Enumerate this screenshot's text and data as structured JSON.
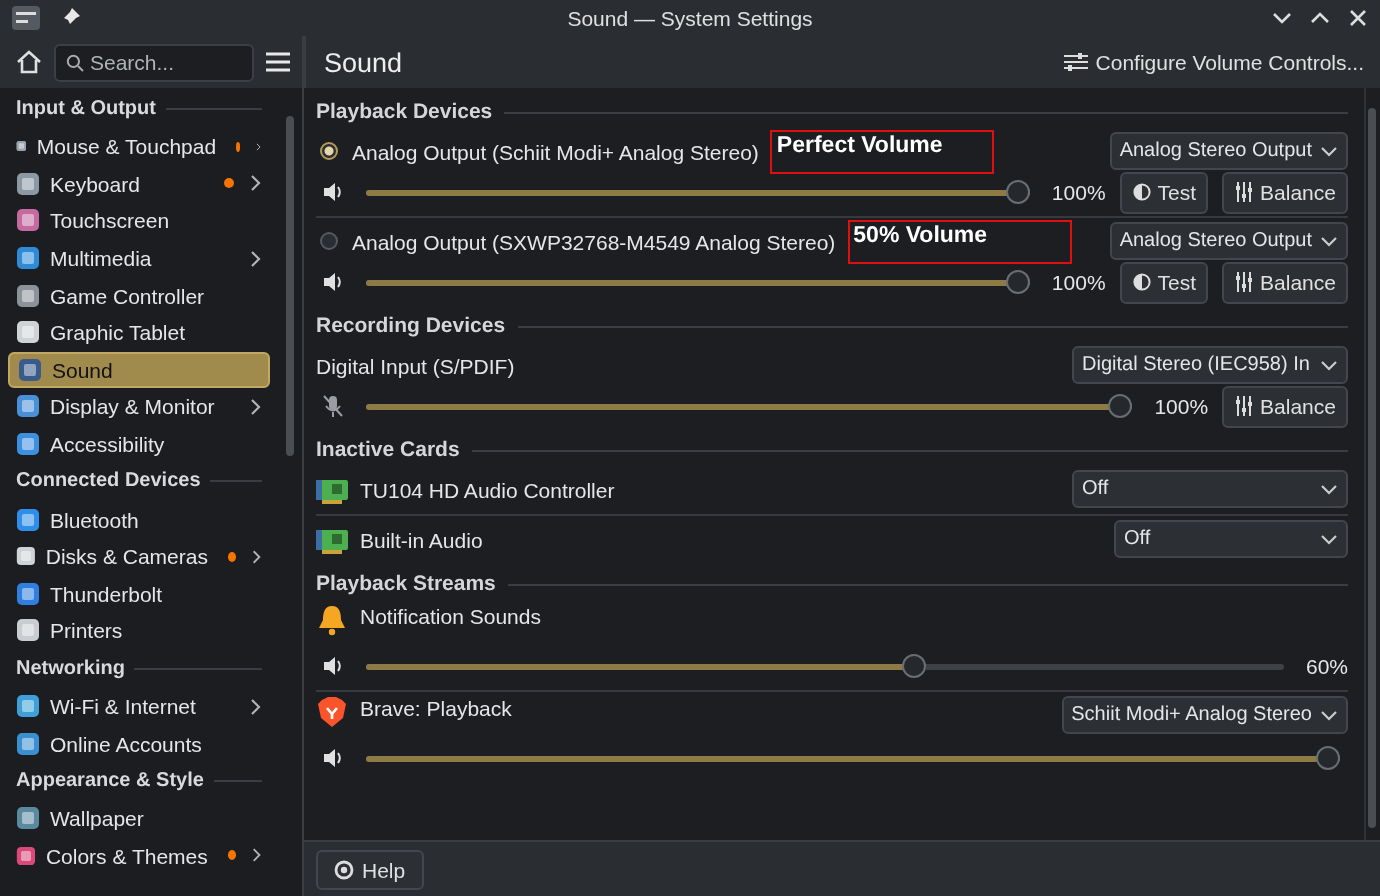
{
  "window": {
    "title": "Sound — System Settings"
  },
  "toolbar": {
    "search": {
      "placeholder": "Search..."
    },
    "page_title": "Sound",
    "configure_button": "Configure Volume Controls..."
  },
  "sidebar": {
    "groups": [
      {
        "heading": "Input & Output",
        "items": [
          {
            "label": "Mouse & Touchpad",
            "selected": false,
            "notified": true,
            "has_children": true
          },
          {
            "label": "Keyboard",
            "selected": false,
            "notified": true,
            "has_children": true
          },
          {
            "label": "Touchscreen",
            "selected": false,
            "notified": false,
            "has_children": false
          },
          {
            "label": "Multimedia",
            "selected": false,
            "notified": false,
            "has_children": true
          },
          {
            "label": "Game Controller",
            "selected": false,
            "notified": false,
            "has_children": false
          },
          {
            "label": "Graphic Tablet",
            "selected": false,
            "notified": false,
            "has_children": false
          },
          {
            "label": "Sound",
            "selected": true,
            "notified": false,
            "has_children": false
          },
          {
            "label": "Display & Monitor",
            "selected": false,
            "notified": false,
            "has_children": true
          },
          {
            "label": "Accessibility",
            "selected": false,
            "notified": false,
            "has_children": false
          }
        ]
      },
      {
        "heading": "Connected Devices",
        "items": [
          {
            "label": "Bluetooth",
            "selected": false,
            "notified": false,
            "has_children": false
          },
          {
            "label": "Disks & Cameras",
            "selected": false,
            "notified": true,
            "has_children": true
          },
          {
            "label": "Thunderbolt",
            "selected": false,
            "notified": false,
            "has_children": false
          },
          {
            "label": "Printers",
            "selected": false,
            "notified": false,
            "has_children": false
          }
        ]
      },
      {
        "heading": "Networking",
        "items": [
          {
            "label": "Wi-Fi & Internet",
            "selected": false,
            "notified": false,
            "has_children": true
          },
          {
            "label": "Online Accounts",
            "selected": false,
            "notified": false,
            "has_children": false
          }
        ]
      },
      {
        "heading": "Appearance & Style",
        "items": [
          {
            "label": "Wallpaper",
            "selected": false,
            "notified": false,
            "has_children": false
          },
          {
            "label": "Colors & Themes",
            "selected": false,
            "notified": true,
            "has_children": true
          }
        ]
      }
    ]
  },
  "sections": [
    {
      "kind": "playback_devices",
      "heading": "Playback Devices",
      "items": [
        {
          "name": "Analog Output (Schiit Modi+ Analog Stereo)",
          "selected": true,
          "note": "Perfect Volume",
          "profile": "Analog Stereo Output",
          "level": 1,
          "reading": "100%",
          "buttons": [
            {
              "kind": "test",
              "label": "Test"
            },
            {
              "kind": "balance",
              "label": "Balance"
            }
          ]
        },
        {
          "name": "Analog Output (SXWP32768-M4549 Analog Stereo)",
          "selected": false,
          "note": "50% Volume",
          "profile": "Analog Stereo Output",
          "level": 1,
          "reading": "100%",
          "buttons": [
            {
              "kind": "test",
              "label": "Test"
            },
            {
              "kind": "balance",
              "label": "Balance"
            }
          ]
        }
      ]
    },
    {
      "kind": "recording_devices",
      "heading": "Recording Devices",
      "items": [
        {
          "name": "Digital Input (S/PDIF)",
          "profile": "Digital Stereo (IEC958) In",
          "level": 1,
          "reading": "100%",
          "buttons": [
            {
              "kind": "balance",
              "label": "Balance"
            }
          ]
        }
      ]
    },
    {
      "kind": "inactive_cards",
      "heading": "Inactive Cards",
      "items": [
        {
          "name": "TU104 HD Audio Controller",
          "profile": "Off"
        },
        {
          "name": "Built-in Audio",
          "profile": "Off"
        }
      ]
    },
    {
      "kind": "playback_streams",
      "heading": "Playback Streams",
      "items": [
        {
          "name": "Notification Sounds",
          "kind": "system_sound",
          "level": 0.6,
          "reading": "60%"
        },
        {
          "name": "Brave: Playback",
          "kind": "application",
          "profile": "Schiit Modi+ Analog Stereo",
          "level": 1
        }
      ]
    }
  ],
  "footer": {
    "help_button": "Help"
  }
}
